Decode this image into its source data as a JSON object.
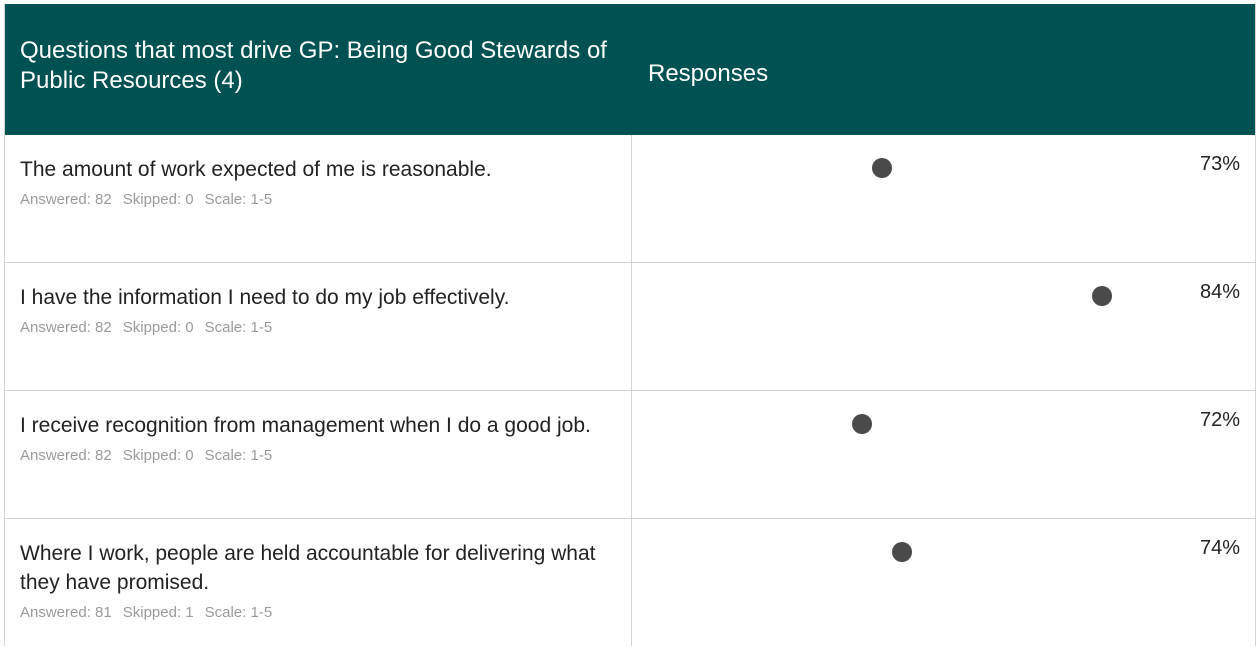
{
  "header": {
    "question_title": "Questions that most drive GP: Being Good Stewards of Public Resources (4)",
    "responses_title": "Responses"
  },
  "rows": [
    {
      "question": "The amount of work expected of me is reasonable.",
      "answered": "Answered: 82",
      "skipped": "Skipped: 0",
      "scale": "Scale: 1-5",
      "percent": "73%",
      "value": 73
    },
    {
      "question": "I have the information I need to do my job effectively.",
      "answered": "Answered: 82",
      "skipped": "Skipped: 0",
      "scale": "Scale: 1-5",
      "percent": "84%",
      "value": 84
    },
    {
      "question": "I receive recognition from management when I do a good job.",
      "answered": "Answered: 82",
      "skipped": "Skipped: 0",
      "scale": "Scale: 1-5",
      "percent": "72%",
      "value": 72
    },
    {
      "question": "Where I work, people are held accountable for delivering what they have promised.",
      "answered": "Answered: 81",
      "skipped": "Skipped: 1",
      "scale": "Scale: 1-5",
      "percent": "74%",
      "value": 74
    }
  ],
  "colors": {
    "header_bg": "#005152",
    "marker": "#4a4a4a"
  }
}
